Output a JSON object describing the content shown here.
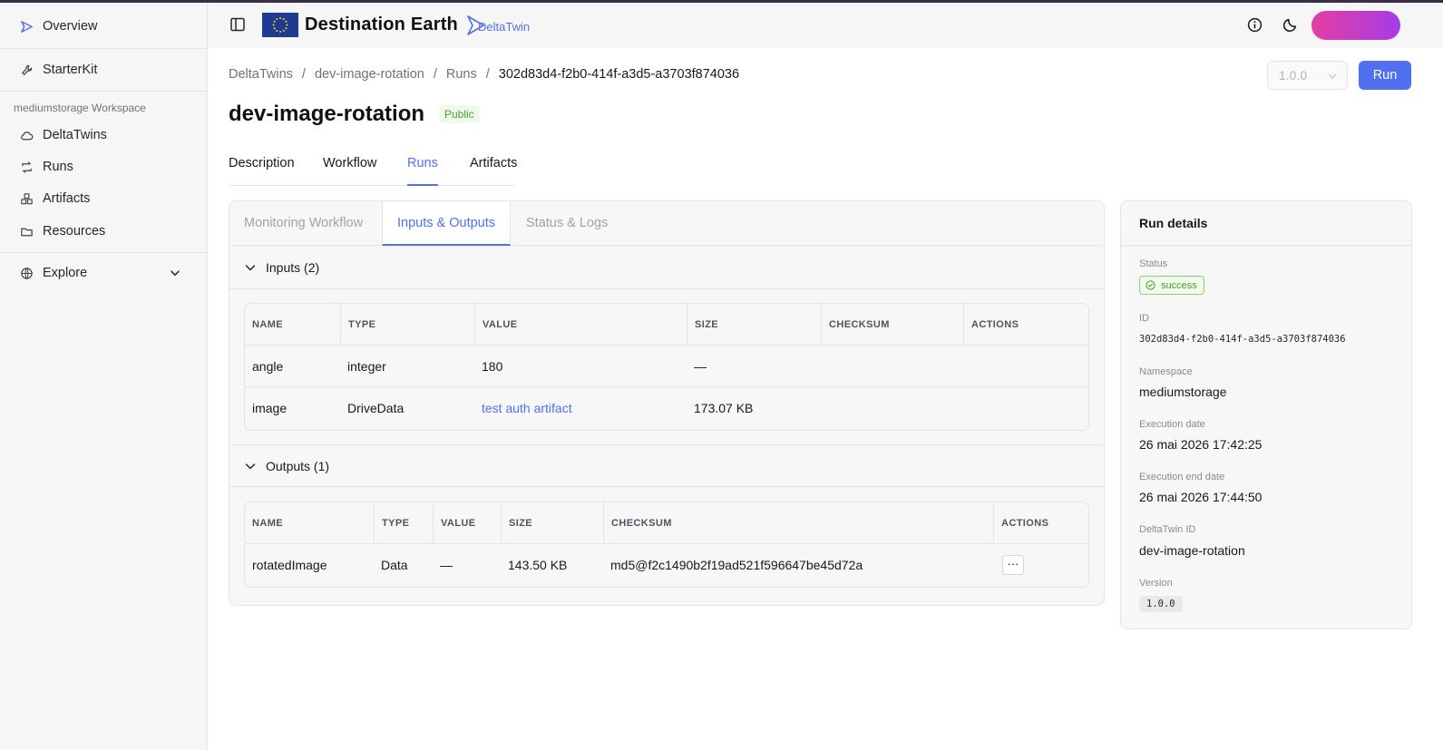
{
  "sidebar": {
    "overview": "Overview",
    "starterkit": "StarterKit",
    "workspace_label": "mediumstorage Workspace",
    "items": [
      {
        "label": "DeltaTwins",
        "icon": "cloud-icon"
      },
      {
        "label": "Runs",
        "icon": "repeat-icon"
      },
      {
        "label": "Artifacts",
        "icon": "boxes-icon"
      },
      {
        "label": "Resources",
        "icon": "folder-icon"
      }
    ],
    "explore": "Explore"
  },
  "header": {
    "brand": "Destination Earth",
    "deltatwin_logo_text": "DeltaTwin"
  },
  "breadcrumb": [
    "DeltaTwins",
    "/",
    "dev-image-rotation",
    "/",
    "Runs",
    "/",
    "302d83d4-f2b0-414f-a3d5-a3703f874036"
  ],
  "version_select": "1.0.0",
  "run_button": "Run",
  "title": "dev-image-rotation",
  "visibility_badge": "Public",
  "tabs": [
    "Description",
    "Workflow",
    "Runs",
    "Artifacts"
  ],
  "active_tab": "Runs",
  "subtabs": [
    "Monitoring Workflow",
    "Inputs & Outputs",
    "Status & Logs"
  ],
  "inputs": {
    "heading": "Inputs (2)",
    "columns": [
      "NAME",
      "TYPE",
      "VALUE",
      "SIZE",
      "CHECKSUM",
      "ACTIONS"
    ],
    "rows": [
      {
        "name": "angle",
        "type": "integer",
        "value": "180",
        "size": "—",
        "checksum": ""
      },
      {
        "name": "image",
        "type": "DriveData",
        "value": "test auth artifact",
        "size": "173.07 KB",
        "checksum": ""
      }
    ]
  },
  "outputs": {
    "heading": "Outputs (1)",
    "columns": [
      "NAME",
      "TYPE",
      "VALUE",
      "SIZE",
      "CHECKSUM",
      "ACTIONS"
    ],
    "rows": [
      {
        "name": "rotatedImage",
        "type": "Data",
        "value": "—",
        "size": "143.50 KB",
        "checksum": "md5@f2c1490b2f19ad521f596647be45d72a",
        "action": "···"
      }
    ]
  },
  "run_details": {
    "heading": "Run details",
    "status_label": "Status",
    "status_value": "success",
    "id_label": "ID",
    "id_value": "302d83d4-f2b0-414f-a3d5-a3703f874036",
    "namespace_label": "Namespace",
    "namespace_value": "mediumstorage",
    "exec_date_label": "Execution date",
    "exec_date_value": "26 mai 2026 17:42:25",
    "exec_end_label": "Execution end date",
    "exec_end_value": "26 mai 2026 17:44:50",
    "deltatwin_id_label": "DeltaTwin ID",
    "deltatwin_id_value": "dev-image-rotation",
    "version_label": "Version",
    "version_value": "1.0.0"
  },
  "colors": {
    "accent": "#4f70f0",
    "success": "#3f9f2c",
    "sidebar_bg": "#f6f6f7"
  }
}
